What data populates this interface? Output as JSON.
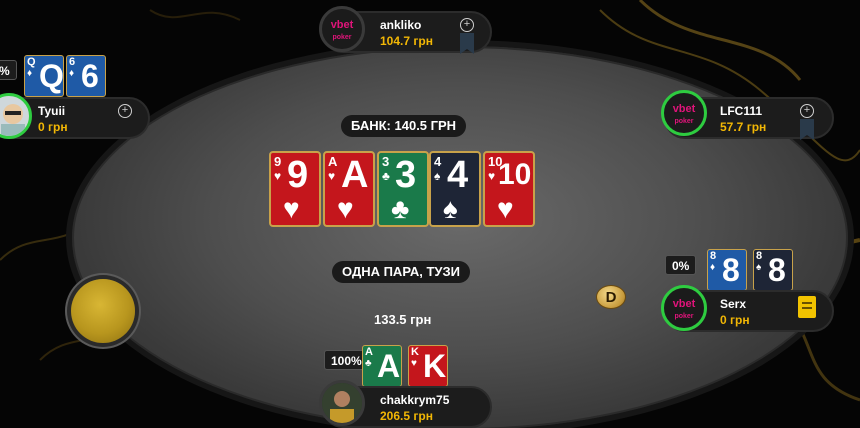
{
  "pot": {
    "label": "БАНК: 140.5 ГРН"
  },
  "hand_result": "ОДНА ПАРА, ТУЗИ",
  "bet_amount": "133.5 грн",
  "dealer_button": "D",
  "board_cards": [
    {
      "rank": "9",
      "suit": "♥",
      "color": "red"
    },
    {
      "rank": "A",
      "suit": "♥",
      "color": "red"
    },
    {
      "rank": "3",
      "suit": "♣",
      "color": "green"
    },
    {
      "rank": "4",
      "suit": "♠",
      "color": "navy"
    },
    {
      "rank": "10",
      "suit": "♥",
      "color": "red"
    }
  ],
  "players": {
    "top": {
      "name": "ankliko",
      "chips": "104.7 грн",
      "avatar_brand": "vbet",
      "avatar_sub": "poker"
    },
    "left": {
      "name": "Tyuii",
      "chips": "0 грн",
      "equity": "%",
      "cards": [
        {
          "rank": "Q",
          "suit": "♦",
          "color": "blue"
        },
        {
          "rank": "6",
          "suit": "♦",
          "color": "blue"
        }
      ]
    },
    "right_top": {
      "name": "LFC111",
      "chips": "57.7 грн",
      "avatar_brand": "vbet",
      "avatar_sub": "poker"
    },
    "right_bottom": {
      "name": "Serx",
      "chips": "0 грн",
      "equity": "0%",
      "avatar_brand": "vbet",
      "avatar_sub": "poker",
      "cards": [
        {
          "rank": "8",
          "suit": "♦",
          "color": "blue"
        },
        {
          "rank": "8",
          "suit": "♠",
          "color": "navy"
        }
      ]
    },
    "hero": {
      "name": "chakkrym75",
      "chips": "206.5 грн",
      "equity": "100%",
      "cards": [
        {
          "rank": "A",
          "suit": "♣",
          "color": "green"
        },
        {
          "rank": "K",
          "suit": "♥",
          "color": "red"
        }
      ]
    }
  },
  "colors": {
    "chips_text": "#f2b705",
    "brand": "#e0147a",
    "active_ring": "#2ecc40",
    "card_border": "#c8a24a"
  }
}
